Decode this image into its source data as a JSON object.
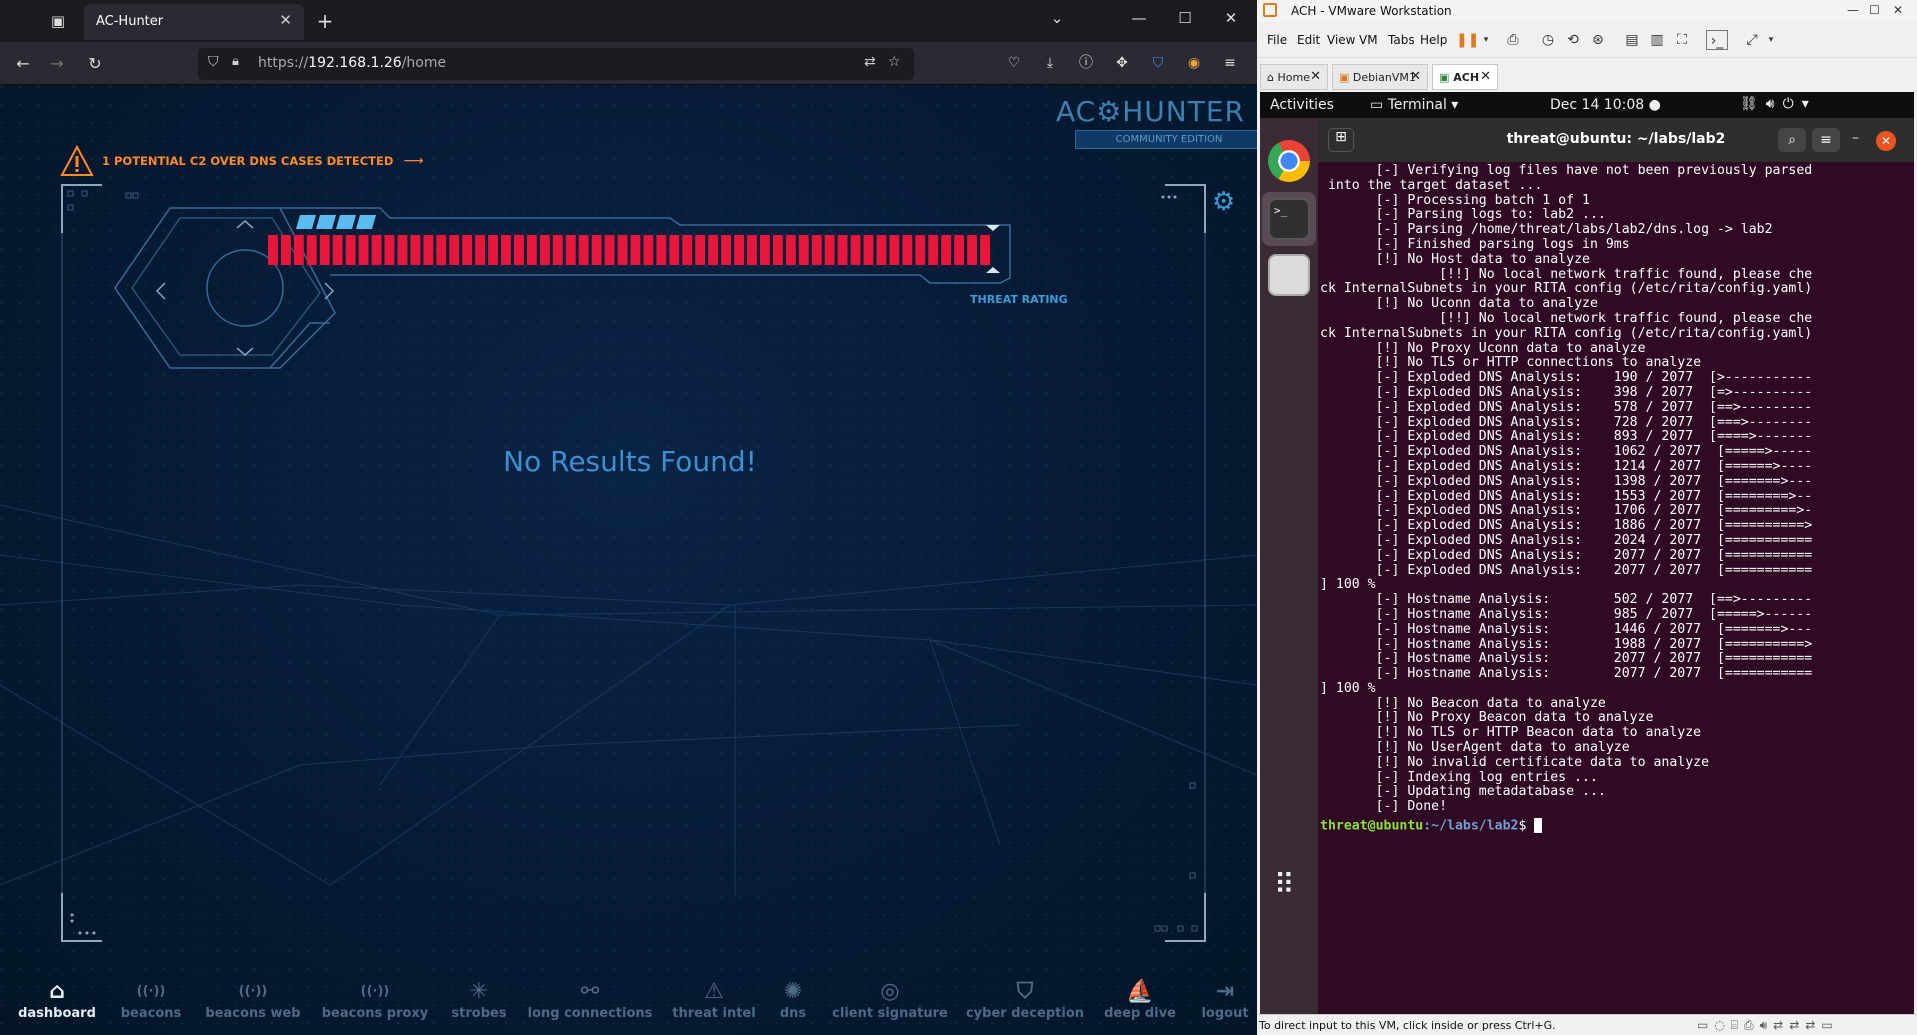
{
  "browser": {
    "tab_title": "AC-Hunter",
    "url_prefix": "https://",
    "url_host": "192.168.1.26",
    "url_path": "/home",
    "window_controls": [
      "—",
      "☐",
      "✕"
    ]
  },
  "achunter": {
    "logo": "AC⚙HUNTER",
    "logo_sub": "COMMUNITY EDITION",
    "alert_text": "1 POTENTIAL C2 OVER DNS CASES DETECTED",
    "threat_label": "THREAT RATING",
    "no_results": "No Results Found!",
    "threat_bar_segments": 56,
    "threat_level_color": "#e8163a",
    "accent_color": "#3d9bd6",
    "nav": [
      {
        "label": "dashboard",
        "icon": "⌂",
        "active": true
      },
      {
        "label": "beacons",
        "icon": "((·))",
        "active": false
      },
      {
        "label": "beacons web",
        "icon": "((·))",
        "active": false
      },
      {
        "label": "beacons proxy",
        "icon": "((·))",
        "active": false
      },
      {
        "label": "strobes",
        "icon": "✳",
        "active": false
      },
      {
        "label": "long connections",
        "icon": "⚯",
        "active": false
      },
      {
        "label": "threat intel",
        "icon": "⚠",
        "active": false
      },
      {
        "label": "dns",
        "icon": "✺",
        "active": false
      },
      {
        "label": "client signature",
        "icon": "◎",
        "active": false
      },
      {
        "label": "cyber deception",
        "icon": "⛉",
        "active": false
      },
      {
        "label": "deep dive",
        "icon": "⛵",
        "active": false
      },
      {
        "label": "logout",
        "icon": "⇥",
        "active": false
      }
    ]
  },
  "vmware": {
    "title": "ACH - VMware Workstation",
    "menus": [
      "File",
      "Edit",
      "View",
      "VM",
      "Tabs",
      "Help"
    ],
    "tabs": [
      "Home",
      "DebianVM1",
      "ACH"
    ],
    "status": "To direct input to this VM, click inside or press Ctrl+G."
  },
  "ubuntu": {
    "activities": "Activities",
    "terminal_menu": "Terminal ▾",
    "clock": "Dec 14  10:08",
    "term_title": "threat@ubuntu: ~/labs/lab2",
    "prompt_user": "threat@ubuntu",
    "prompt_path": ":~/labs/lab2",
    "prompt_sym": "$ ",
    "lines": [
      "       [-] Verifying log files have not been previously parsed",
      " into the target dataset ...",
      "       [-] Processing batch 1 of 1",
      "       [-] Parsing logs to: lab2 ...",
      "       [-] Parsing /home/threat/labs/lab2/dns.log -> lab2",
      "       [-] Finished parsing logs in 9ms",
      "       [!] No Host data to analyze",
      "               [!!] No local network traffic found, please che",
      "ck InternalSubnets in your RITA config (/etc/rita/config.yaml)",
      "       [!] No Uconn data to analyze",
      "               [!!] No local network traffic found, please che",
      "ck InternalSubnets in your RITA config (/etc/rita/config.yaml)",
      "       [!] No Proxy Uconn data to analyze",
      "       [!] No TLS or HTTP connections to analyze",
      "       [-] Exploded DNS Analysis:    190 / 2077  [>-----------",
      "       [-] Exploded DNS Analysis:    398 / 2077  [=>----------",
      "       [-] Exploded DNS Analysis:    578 / 2077  [==>---------",
      "       [-] Exploded DNS Analysis:    728 / 2077  [===>--------",
      "       [-] Exploded DNS Analysis:    893 / 2077  [====>-------",
      "       [-] Exploded DNS Analysis:    1062 / 2077  [=====>-----",
      "       [-] Exploded DNS Analysis:    1214 / 2077  [======>----",
      "       [-] Exploded DNS Analysis:    1398 / 2077  [=======>---",
      "       [-] Exploded DNS Analysis:    1553 / 2077  [========>--",
      "       [-] Exploded DNS Analysis:    1706 / 2077  [=========>-",
      "       [-] Exploded DNS Analysis:    1886 / 2077  [==========>",
      "       [-] Exploded DNS Analysis:    2024 / 2077  [===========",
      "       [-] Exploded DNS Analysis:    2077 / 2077  [===========",
      "       [-] Exploded DNS Analysis:    2077 / 2077  [===========",
      "] 100 %",
      "       [-] Hostname Analysis:        502 / 2077  [==>---------",
      "       [-] Hostname Analysis:        985 / 2077  [=====>------",
      "       [-] Hostname Analysis:        1446 / 2077  [=======>---",
      "       [-] Hostname Analysis:        1988 / 2077  [==========>",
      "       [-] Hostname Analysis:        2077 / 2077  [===========",
      "       [-] Hostname Analysis:        2077 / 2077  [===========",
      "] 100 %",
      "       [!] No Beacon data to analyze",
      "       [!] No Proxy Beacon data to analyze",
      "       [!] No TLS or HTTP Beacon data to analyze",
      "       [!] No UserAgent data to analyze",
      "       [!] No invalid certificate data to analyze",
      "       [-] Indexing log entries ...",
      "       [-] Updating metadatabase ...",
      "       [-] Done!"
    ]
  }
}
